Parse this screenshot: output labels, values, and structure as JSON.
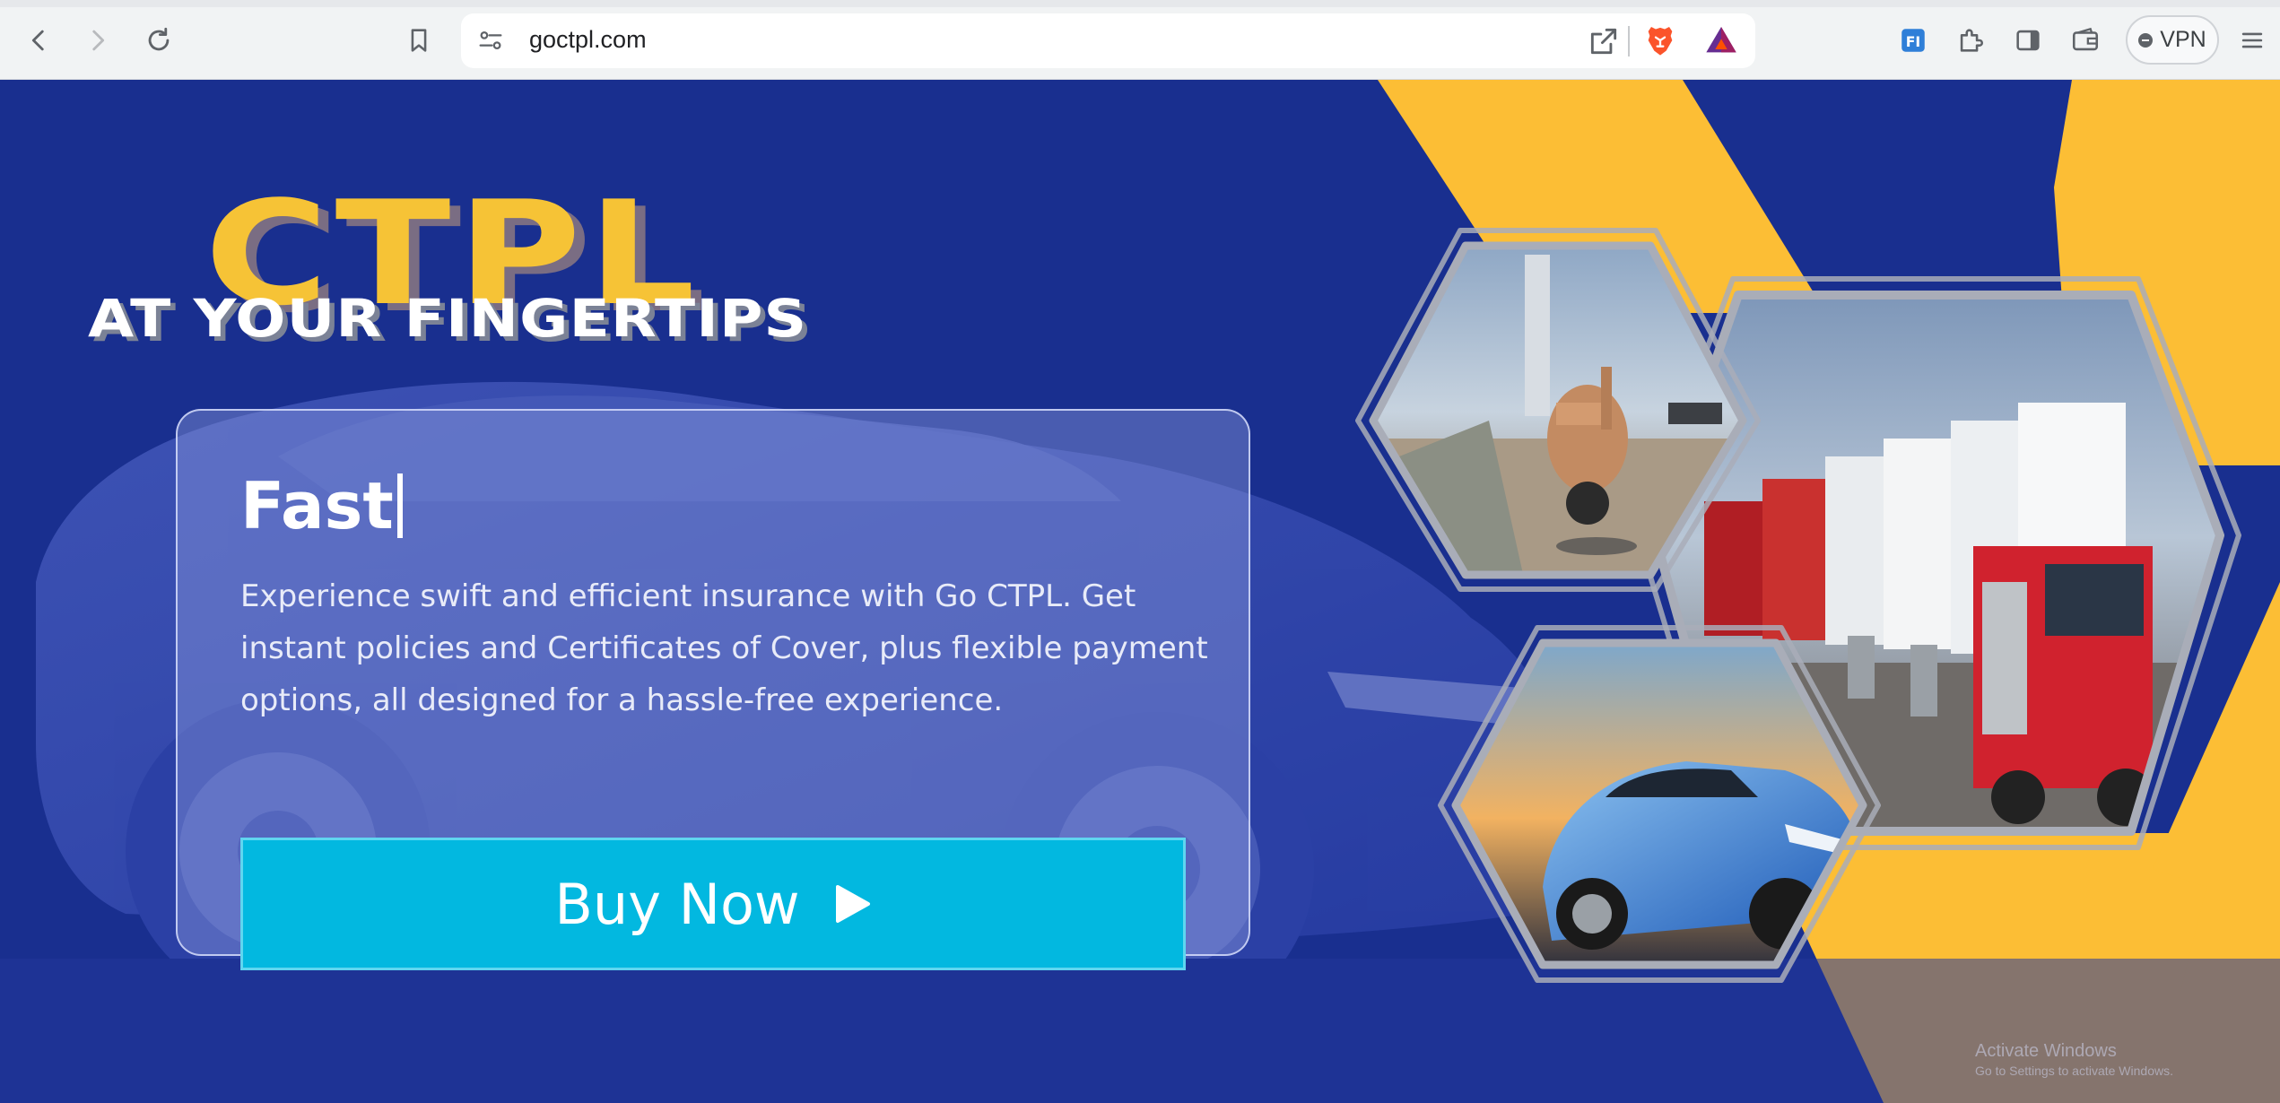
{
  "browser": {
    "url": "goctpl.com",
    "vpn_label": "VPN"
  },
  "hero": {
    "logo_title": "CTPL",
    "logo_tagline": "AT YOUR FINGERTIPS",
    "card": {
      "title": "Fast",
      "body": "Experience swift and efficient insurance with Go CTPL. Get instant policies and Certificates of Cover, plus flexible payment options, all designed for a hassle-free experience.",
      "cta_label": "Buy Now"
    },
    "images": [
      "scooter-photo",
      "trucks-photo",
      "sports-car-photo"
    ]
  },
  "watermark": {
    "line1": "Activate Windows",
    "line2": "Go to Settings to activate Windows."
  },
  "colors": {
    "hero_blue": "#192f8f",
    "accent_yellow": "#fcbe35",
    "cta_cyan": "#02b8e0"
  }
}
